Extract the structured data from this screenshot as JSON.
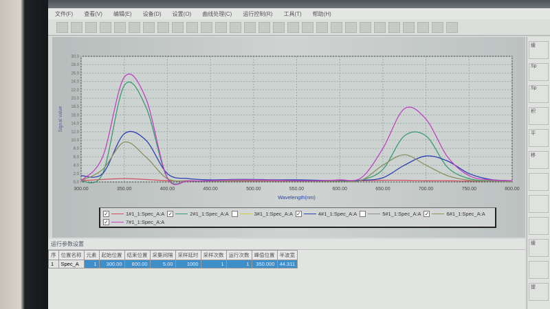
{
  "menu": [
    "文件(F)",
    "查看(V)",
    "编辑(E)",
    "设备(D)",
    "设置(O)",
    "曲线处理(C)",
    "运行控制(R)",
    "工具(T)",
    "帮助(H)"
  ],
  "toolbar_icons": [
    "new-icon",
    "open-icon",
    "dropdown-icon",
    "save-icon",
    "filter1-icon",
    "filter2-icon",
    "filter3-icon",
    "display-icon",
    "compare-icon",
    "color-icon",
    "settings-icon",
    "grid-icon",
    "table-icon",
    "zoom-icon",
    "peak-icon",
    "report-icon",
    "layout-icon",
    "split-icon",
    "cross-icon",
    "print-icon",
    "device-icon",
    "export-icon",
    "run-icon",
    "loop-icon",
    "stop-icon",
    "pause-icon",
    "record-icon",
    "help-icon"
  ],
  "chart_data": {
    "type": "line",
    "xlabel": "Wavelength(nm)",
    "ylabel": "Signal value",
    "xlim": [
      300,
      800
    ],
    "ylim": [
      0,
      30
    ],
    "xticks": [
      "300.00",
      "350.00",
      "400.00",
      "450.00",
      "500.00",
      "550.00",
      "600.00",
      "650.00",
      "700.00",
      "750.00",
      "800.00"
    ],
    "yticks": [
      "0.0",
      "2.0",
      "4.0",
      "6.0",
      "8.0",
      "10.0",
      "12.0",
      "14.0",
      "16.0",
      "18.0",
      "20.0",
      "22.0",
      "24.0",
      "26.0",
      "28.0",
      "30.0"
    ],
    "grid": true,
    "x": [
      300,
      325,
      350,
      375,
      400,
      425,
      450,
      475,
      500,
      525,
      550,
      575,
      600,
      625,
      650,
      675,
      700,
      725,
      750,
      775,
      800
    ],
    "series": [
      {
        "name": "1#1_1:Spec_A:A",
        "color": "#d05060",
        "checked": true,
        "values": [
          0.3,
          0.6,
          0.8,
          0.6,
          0.3,
          0.2,
          0.2,
          0.2,
          0.2,
          0.2,
          0.2,
          0.2,
          0.2,
          0.3,
          0.4,
          0.4,
          0.3,
          0.3,
          0.2,
          0.2,
          0.2
        ]
      },
      {
        "name": "2#1_1:Spec_A:A",
        "color": "#3a9a70",
        "checked": true,
        "values": [
          0.2,
          2,
          23,
          18,
          1,
          0.3,
          0.2,
          0.3,
          0.4,
          0.3,
          0.3,
          0.2,
          0.3,
          0.5,
          3,
          11,
          11,
          3.5,
          0.8,
          0.3,
          0.2
        ]
      },
      {
        "name": "3#1_1:Spec_A:A",
        "color": "#c8d040",
        "checked": false,
        "values": null
      },
      {
        "name": "4#1_1:Spec_A:A",
        "color": "#2a40b0",
        "checked": true,
        "values": [
          1.5,
          2,
          11.5,
          10,
          2,
          0.8,
          0.5,
          0.6,
          0.6,
          0.5,
          0.5,
          0.4,
          0.3,
          0.4,
          1,
          4,
          6.2,
          5,
          2,
          0.6,
          0.3
        ]
      },
      {
        "name": "5#1_1:Spec_A:A",
        "color": "#8a8a8a",
        "checked": false,
        "values": null
      },
      {
        "name": "6#1_1:Spec_A:A",
        "color": "#8a9060",
        "checked": true,
        "values": [
          0.3,
          3,
          9.5,
          6,
          0.8,
          0.3,
          0.2,
          0.3,
          0.3,
          0.3,
          0.2,
          0.2,
          0.2,
          0.4,
          4,
          6.5,
          4,
          1.5,
          0.4,
          0.2,
          0.1
        ]
      },
      {
        "name": "7#1_1:Spec_A:A",
        "color": "#c040c0",
        "checked": true,
        "values": [
          0.3,
          6,
          25,
          20,
          1,
          0.3,
          0.3,
          0.5,
          0.5,
          0.4,
          0.3,
          0.3,
          0.5,
          1,
          8,
          17.5,
          15,
          6,
          1.5,
          0.5,
          0.3
        ]
      }
    ]
  },
  "params": {
    "title": "运行参数设置",
    "headers": [
      "序",
      "位置名称",
      "元素",
      "起始位置",
      "结束位置",
      "采集间隔",
      "采样延时",
      "采样次数",
      "运行次数",
      "峰值位置",
      "半波宽"
    ],
    "rows": [
      [
        "1",
        "Spec_A",
        "1",
        "300.00",
        "800.00",
        "5.00",
        "1000",
        "1",
        "1",
        "350.000",
        "44.311"
      ]
    ]
  },
  "right_panel": {
    "labels": [
      "缓",
      "Sp",
      "Sp",
      "积",
      "平",
      "移",
      "",
      "",
      "",
      "缓",
      "",
      "提"
    ]
  }
}
